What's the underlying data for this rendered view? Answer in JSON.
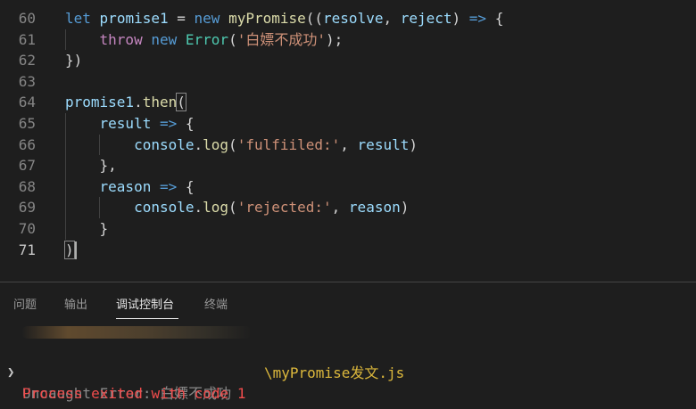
{
  "editor": {
    "lines": [
      {
        "num": "60",
        "tokens": [
          {
            "t": "let",
            "c": "kw"
          },
          {
            "t": " ",
            "c": "pl"
          },
          {
            "t": "promise1",
            "c": "var"
          },
          {
            "t": " = ",
            "c": "pl"
          },
          {
            "t": "new",
            "c": "kw"
          },
          {
            "t": " ",
            "c": "pl"
          },
          {
            "t": "myPromise",
            "c": "fn"
          },
          {
            "t": "((",
            "c": "pl"
          },
          {
            "t": "resolve",
            "c": "var"
          },
          {
            "t": ", ",
            "c": "pl"
          },
          {
            "t": "reject",
            "c": "var"
          },
          {
            "t": ") ",
            "c": "pl"
          },
          {
            "t": "=>",
            "c": "kw"
          },
          {
            "t": " {",
            "c": "pl"
          }
        ]
      },
      {
        "num": "61",
        "tokens": [
          {
            "t": "    ",
            "c": "pl"
          },
          {
            "t": "throw",
            "c": "ctl"
          },
          {
            "t": " ",
            "c": "pl"
          },
          {
            "t": "new",
            "c": "kw"
          },
          {
            "t": " ",
            "c": "pl"
          },
          {
            "t": "Error",
            "c": "cls"
          },
          {
            "t": "(",
            "c": "pl"
          },
          {
            "t": "'白嫖不成功'",
            "c": "str"
          },
          {
            "t": ");",
            "c": "pl"
          }
        ]
      },
      {
        "num": "62",
        "tokens": [
          {
            "t": "})",
            "c": "pl"
          }
        ]
      },
      {
        "num": "63",
        "tokens": []
      },
      {
        "num": "64",
        "tokens": [
          {
            "t": "promise1",
            "c": "var"
          },
          {
            "t": ".",
            "c": "pl"
          },
          {
            "t": "then",
            "c": "fn"
          },
          {
            "t": "(",
            "c": "pl",
            "hl": true
          }
        ]
      },
      {
        "num": "65",
        "tokens": [
          {
            "t": "    ",
            "c": "pl"
          },
          {
            "t": "result",
            "c": "var"
          },
          {
            "t": " ",
            "c": "pl"
          },
          {
            "t": "=>",
            "c": "kw"
          },
          {
            "t": " {",
            "c": "pl"
          }
        ]
      },
      {
        "num": "66",
        "tokens": [
          {
            "t": "        ",
            "c": "pl"
          },
          {
            "t": "console",
            "c": "var"
          },
          {
            "t": ".",
            "c": "pl"
          },
          {
            "t": "log",
            "c": "fn"
          },
          {
            "t": "(",
            "c": "pl"
          },
          {
            "t": "'fulfiiled:'",
            "c": "str"
          },
          {
            "t": ", ",
            "c": "pl"
          },
          {
            "t": "result",
            "c": "var"
          },
          {
            "t": ")",
            "c": "pl"
          }
        ]
      },
      {
        "num": "67",
        "tokens": [
          {
            "t": "    ",
            "c": "pl"
          },
          {
            "t": "},",
            "c": "pl"
          }
        ]
      },
      {
        "num": "68",
        "tokens": [
          {
            "t": "    ",
            "c": "pl"
          },
          {
            "t": "reason",
            "c": "var"
          },
          {
            "t": " ",
            "c": "pl"
          },
          {
            "t": "=>",
            "c": "kw"
          },
          {
            "t": " {",
            "c": "pl"
          }
        ]
      },
      {
        "num": "69",
        "tokens": [
          {
            "t": "        ",
            "c": "pl"
          },
          {
            "t": "console",
            "c": "var"
          },
          {
            "t": ".",
            "c": "pl"
          },
          {
            "t": "log",
            "c": "fn"
          },
          {
            "t": "(",
            "c": "pl"
          },
          {
            "t": "'rejected:'",
            "c": "str"
          },
          {
            "t": ", ",
            "c": "pl"
          },
          {
            "t": "reason",
            "c": "var"
          },
          {
            "t": ")",
            "c": "pl"
          }
        ]
      },
      {
        "num": "70",
        "tokens": [
          {
            "t": "    ",
            "c": "pl"
          },
          {
            "t": "}",
            "c": "pl"
          }
        ]
      },
      {
        "num": "71",
        "active": true,
        "tokens": [
          {
            "t": ")",
            "c": "pl",
            "hl": true
          }
        ],
        "cursor": true
      }
    ]
  },
  "panel": {
    "tabs": [
      {
        "label": "问题",
        "active": false
      },
      {
        "label": "输出",
        "active": false
      },
      {
        "label": "调试控制台",
        "active": true
      },
      {
        "label": "终端",
        "active": false
      }
    ]
  },
  "console": {
    "file_path": "\\myPromise发文.js",
    "error_line": "Uncaught Error: 白嫖不成功",
    "exit_line": "Process exited with code 1",
    "expand_icon": "chevron-right-icon"
  },
  "colors": {
    "background": "#1e1e1e",
    "keyword": "#569cd6",
    "function": "#dcdcaa",
    "variable": "#9cdcfe",
    "string": "#ce9178",
    "class": "#4ec9b0",
    "control": "#c586c0",
    "path": "#dcb83c",
    "exit_error": "#f14c4c"
  }
}
